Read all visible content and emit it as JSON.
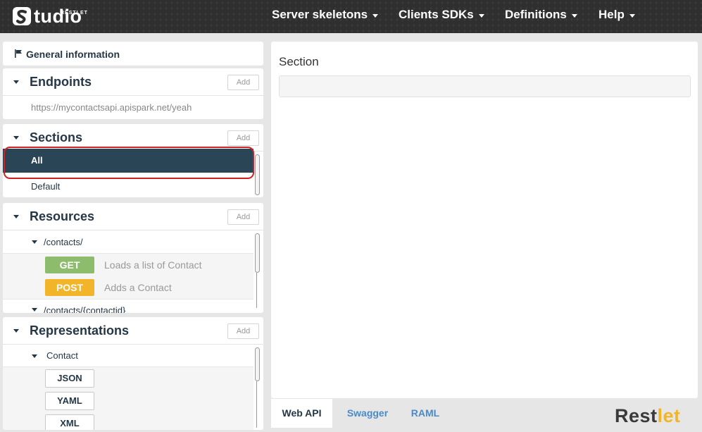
{
  "app": {
    "logo_small": "RESTLET",
    "logo_text": "tudio",
    "logo_icon": "restlet-s-icon"
  },
  "nav": [
    {
      "label": "Server skeletons"
    },
    {
      "label": "Clients SDKs"
    },
    {
      "label": "Definitions"
    },
    {
      "label": "Help"
    }
  ],
  "sidebar": {
    "general_info": {
      "label": "General information",
      "icon": "flag-icon"
    },
    "endpoints": {
      "title": "Endpoints",
      "add_label": "Add",
      "items": [
        "https://mycontactsapi.apispark.net/yeah"
      ]
    },
    "sections": {
      "title": "Sections",
      "add_label": "Add",
      "items": [
        {
          "label": "All",
          "selected": true
        },
        {
          "label": "Default",
          "selected": false
        }
      ]
    },
    "resources": {
      "title": "Resources",
      "add_label": "Add",
      "items": [
        {
          "path": "/contacts/",
          "methods": [
            {
              "verb": "GET",
              "description": "Loads a list of Contact",
              "color": "#8cbc6c"
            },
            {
              "verb": "POST",
              "description": "Adds a Contact",
              "color": "#f2b52a"
            }
          ]
        },
        {
          "path": "/contacts/{contactid}"
        }
      ]
    },
    "representations": {
      "title": "Representations",
      "add_label": "Add",
      "items": [
        {
          "name": "Contact",
          "formats": [
            "JSON",
            "YAML",
            "XML"
          ]
        }
      ]
    }
  },
  "main": {
    "title": "Section",
    "section_value": ""
  },
  "tabs": [
    {
      "label": "Web API",
      "active": true
    },
    {
      "label": "Swagger",
      "active": false
    },
    {
      "label": "RAML",
      "active": false
    }
  ],
  "brand": {
    "part1": "Rest",
    "part2": "let",
    "color1": "#3a3a3a",
    "color2": "#f2b52a"
  },
  "colors": {
    "selected_bg": "#2a4556",
    "highlight": "#d21f1f",
    "link": "#4a8ac9"
  }
}
